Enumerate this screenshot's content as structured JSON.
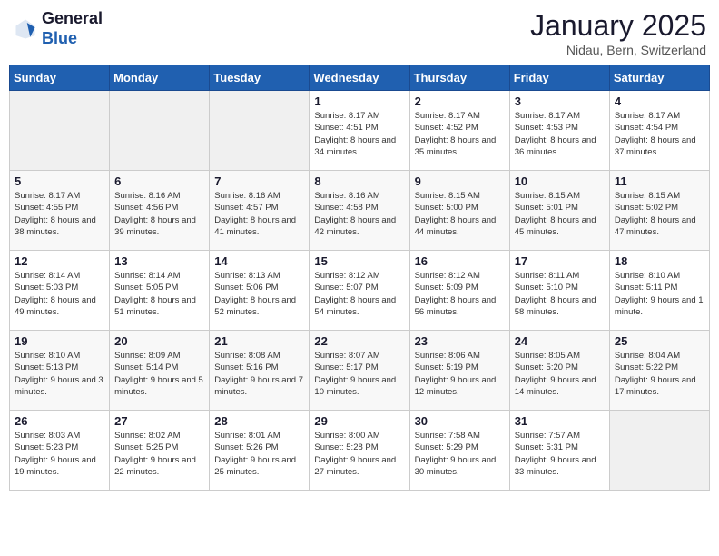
{
  "header": {
    "logo_general": "General",
    "logo_blue": "Blue",
    "month_year": "January 2025",
    "location": "Nidau, Bern, Switzerland"
  },
  "days_of_week": [
    "Sunday",
    "Monday",
    "Tuesday",
    "Wednesday",
    "Thursday",
    "Friday",
    "Saturday"
  ],
  "weeks": [
    [
      {
        "day": "",
        "info": ""
      },
      {
        "day": "",
        "info": ""
      },
      {
        "day": "",
        "info": ""
      },
      {
        "day": "1",
        "info": "Sunrise: 8:17 AM\nSunset: 4:51 PM\nDaylight: 8 hours\nand 34 minutes."
      },
      {
        "day": "2",
        "info": "Sunrise: 8:17 AM\nSunset: 4:52 PM\nDaylight: 8 hours\nand 35 minutes."
      },
      {
        "day": "3",
        "info": "Sunrise: 8:17 AM\nSunset: 4:53 PM\nDaylight: 8 hours\nand 36 minutes."
      },
      {
        "day": "4",
        "info": "Sunrise: 8:17 AM\nSunset: 4:54 PM\nDaylight: 8 hours\nand 37 minutes."
      }
    ],
    [
      {
        "day": "5",
        "info": "Sunrise: 8:17 AM\nSunset: 4:55 PM\nDaylight: 8 hours\nand 38 minutes."
      },
      {
        "day": "6",
        "info": "Sunrise: 8:16 AM\nSunset: 4:56 PM\nDaylight: 8 hours\nand 39 minutes."
      },
      {
        "day": "7",
        "info": "Sunrise: 8:16 AM\nSunset: 4:57 PM\nDaylight: 8 hours\nand 41 minutes."
      },
      {
        "day": "8",
        "info": "Sunrise: 8:16 AM\nSunset: 4:58 PM\nDaylight: 8 hours\nand 42 minutes."
      },
      {
        "day": "9",
        "info": "Sunrise: 8:15 AM\nSunset: 5:00 PM\nDaylight: 8 hours\nand 44 minutes."
      },
      {
        "day": "10",
        "info": "Sunrise: 8:15 AM\nSunset: 5:01 PM\nDaylight: 8 hours\nand 45 minutes."
      },
      {
        "day": "11",
        "info": "Sunrise: 8:15 AM\nSunset: 5:02 PM\nDaylight: 8 hours\nand 47 minutes."
      }
    ],
    [
      {
        "day": "12",
        "info": "Sunrise: 8:14 AM\nSunset: 5:03 PM\nDaylight: 8 hours\nand 49 minutes."
      },
      {
        "day": "13",
        "info": "Sunrise: 8:14 AM\nSunset: 5:05 PM\nDaylight: 8 hours\nand 51 minutes."
      },
      {
        "day": "14",
        "info": "Sunrise: 8:13 AM\nSunset: 5:06 PM\nDaylight: 8 hours\nand 52 minutes."
      },
      {
        "day": "15",
        "info": "Sunrise: 8:12 AM\nSunset: 5:07 PM\nDaylight: 8 hours\nand 54 minutes."
      },
      {
        "day": "16",
        "info": "Sunrise: 8:12 AM\nSunset: 5:09 PM\nDaylight: 8 hours\nand 56 minutes."
      },
      {
        "day": "17",
        "info": "Sunrise: 8:11 AM\nSunset: 5:10 PM\nDaylight: 8 hours\nand 58 minutes."
      },
      {
        "day": "18",
        "info": "Sunrise: 8:10 AM\nSunset: 5:11 PM\nDaylight: 9 hours\nand 1 minute."
      }
    ],
    [
      {
        "day": "19",
        "info": "Sunrise: 8:10 AM\nSunset: 5:13 PM\nDaylight: 9 hours\nand 3 minutes."
      },
      {
        "day": "20",
        "info": "Sunrise: 8:09 AM\nSunset: 5:14 PM\nDaylight: 9 hours\nand 5 minutes."
      },
      {
        "day": "21",
        "info": "Sunrise: 8:08 AM\nSunset: 5:16 PM\nDaylight: 9 hours\nand 7 minutes."
      },
      {
        "day": "22",
        "info": "Sunrise: 8:07 AM\nSunset: 5:17 PM\nDaylight: 9 hours\nand 10 minutes."
      },
      {
        "day": "23",
        "info": "Sunrise: 8:06 AM\nSunset: 5:19 PM\nDaylight: 9 hours\nand 12 minutes."
      },
      {
        "day": "24",
        "info": "Sunrise: 8:05 AM\nSunset: 5:20 PM\nDaylight: 9 hours\nand 14 minutes."
      },
      {
        "day": "25",
        "info": "Sunrise: 8:04 AM\nSunset: 5:22 PM\nDaylight: 9 hours\nand 17 minutes."
      }
    ],
    [
      {
        "day": "26",
        "info": "Sunrise: 8:03 AM\nSunset: 5:23 PM\nDaylight: 9 hours\nand 19 minutes."
      },
      {
        "day": "27",
        "info": "Sunrise: 8:02 AM\nSunset: 5:25 PM\nDaylight: 9 hours\nand 22 minutes."
      },
      {
        "day": "28",
        "info": "Sunrise: 8:01 AM\nSunset: 5:26 PM\nDaylight: 9 hours\nand 25 minutes."
      },
      {
        "day": "29",
        "info": "Sunrise: 8:00 AM\nSunset: 5:28 PM\nDaylight: 9 hours\nand 27 minutes."
      },
      {
        "day": "30",
        "info": "Sunrise: 7:58 AM\nSunset: 5:29 PM\nDaylight: 9 hours\nand 30 minutes."
      },
      {
        "day": "31",
        "info": "Sunrise: 7:57 AM\nSunset: 5:31 PM\nDaylight: 9 hours\nand 33 minutes."
      },
      {
        "day": "",
        "info": ""
      }
    ]
  ]
}
